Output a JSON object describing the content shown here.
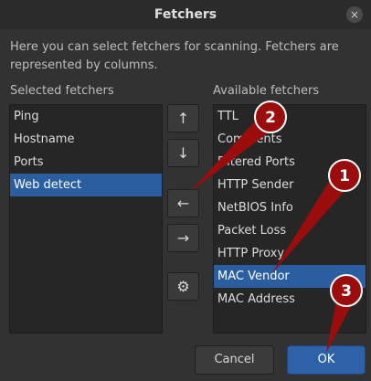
{
  "window": {
    "title": "Fetchers",
    "close_glyph": "×"
  },
  "description": "Here you can select fetchers for scanning. Fetchers are represented by columns.",
  "selected_list": {
    "label": "Selected fetchers",
    "items": [
      {
        "label": "Ping",
        "selected": false
      },
      {
        "label": "Hostname",
        "selected": false
      },
      {
        "label": "Ports",
        "selected": false
      },
      {
        "label": "Web detect",
        "selected": true
      }
    ]
  },
  "available_list": {
    "label": "Available fetchers",
    "items": [
      {
        "label": "TTL",
        "selected": false
      },
      {
        "label": "Comments",
        "selected": false
      },
      {
        "label": "Filtered Ports",
        "selected": false
      },
      {
        "label": "HTTP Sender",
        "selected": false
      },
      {
        "label": "NetBIOS Info",
        "selected": false
      },
      {
        "label": "Packet Loss",
        "selected": false
      },
      {
        "label": "HTTP Proxy",
        "selected": false
      },
      {
        "label": "MAC Vendor",
        "selected": true
      },
      {
        "label": "MAC Address",
        "selected": false
      }
    ]
  },
  "tools": {
    "up": {
      "glyph": "↑",
      "icon": "arrow-up-icon"
    },
    "down": {
      "glyph": "↓",
      "icon": "arrow-down-icon"
    },
    "left": {
      "glyph": "←",
      "icon": "arrow-left-icon"
    },
    "right": {
      "glyph": "→",
      "icon": "arrow-right-icon"
    },
    "settings": {
      "glyph": "⚙",
      "icon": "gear-icon"
    }
  },
  "buttons": {
    "cancel": "Cancel",
    "ok": "OK"
  },
  "callouts": {
    "badge1": "1",
    "badge2": "2",
    "badge3": "3",
    "color": "#9b0d0d"
  },
  "colors": {
    "selection": "#2b5ea0",
    "ok_button": "#2d62a8",
    "background": "#323232"
  }
}
